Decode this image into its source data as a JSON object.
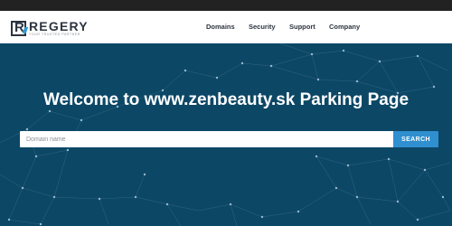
{
  "brand": {
    "name": "REGERY",
    "tagline": "YOUR TRUSTED PARTNER",
    "accent_color": "#2d9ad6"
  },
  "nav": {
    "items": [
      {
        "label": "Domains"
      },
      {
        "label": "Security"
      },
      {
        "label": "Support"
      },
      {
        "label": "Company"
      }
    ]
  },
  "hero": {
    "headline": "Welcome to www.zenbeauty.sk Parking Page",
    "background_color": "#0c4766"
  },
  "search": {
    "placeholder": "Domain name",
    "value": "",
    "button_label": "SEARCH",
    "button_color": "#2f8fcf"
  }
}
